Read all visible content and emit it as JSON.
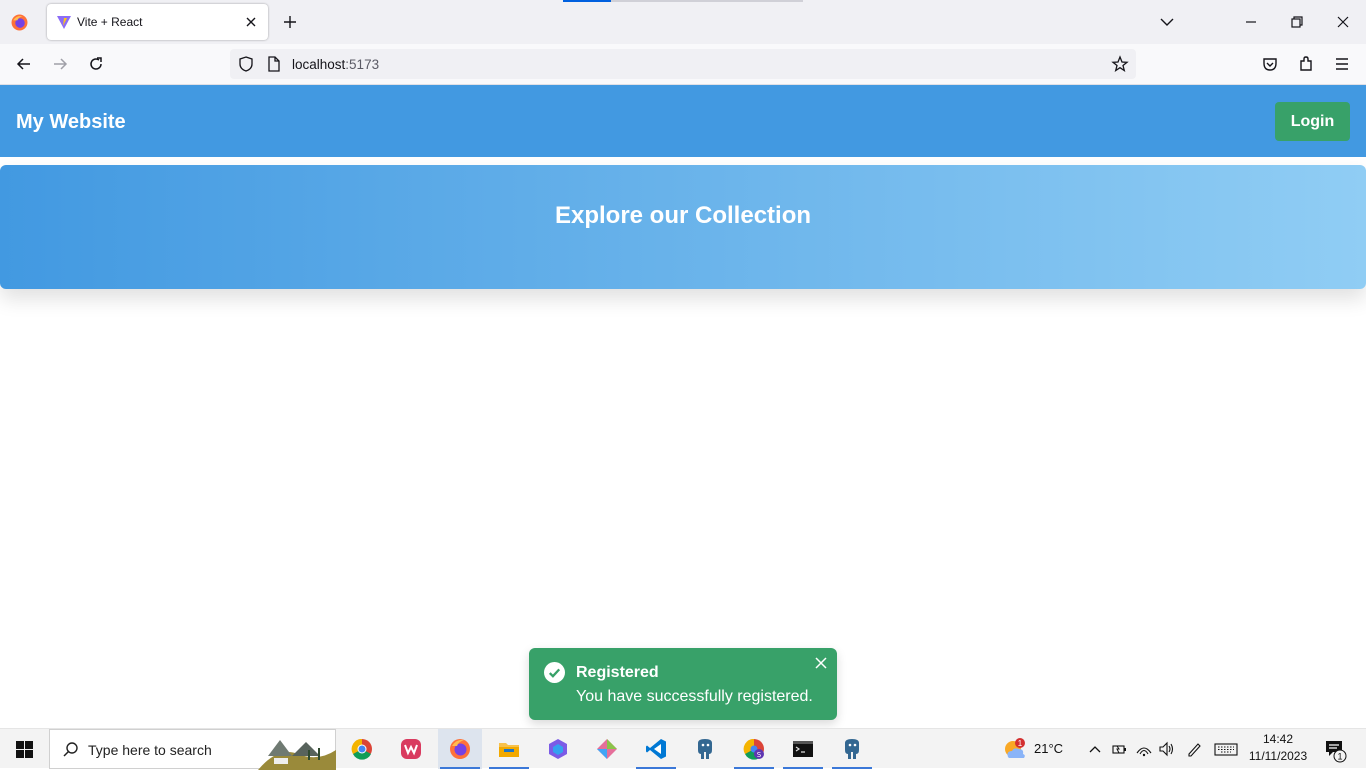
{
  "browser": {
    "tab_title": "Vite + React",
    "url_host": "localhost",
    "url_port": ":5173"
  },
  "site": {
    "title": "My Website",
    "login_label": "Login",
    "hero_title": "Explore our Collection"
  },
  "toast": {
    "title": "Registered",
    "message": "You have successfully registered."
  },
  "taskbar": {
    "search_placeholder": "Type here to search",
    "weather_temp": "21°C",
    "weather_badge": "1",
    "time": "14:42",
    "date": "11/11/2023",
    "notification_count": "1"
  },
  "colors": {
    "header": "#4299e1",
    "hero_start": "#4299e1",
    "hero_end": "#90cdf4",
    "success": "#38a169"
  }
}
